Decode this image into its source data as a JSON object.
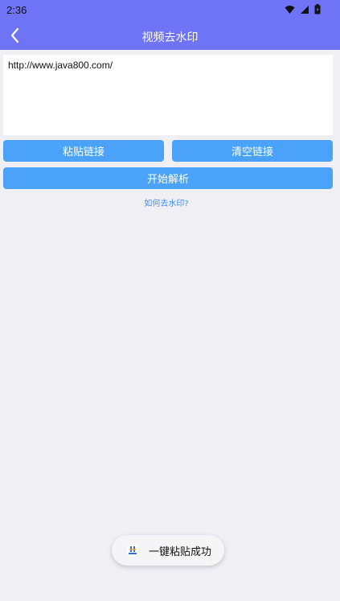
{
  "status_bar": {
    "time": "2:36"
  },
  "app_bar": {
    "title": "视频去水印"
  },
  "url_input": {
    "value": "http://www.java800.com/"
  },
  "buttons": {
    "paste_label": "粘贴链接",
    "clear_label": "清空链接",
    "parse_label": "开始解析"
  },
  "help": {
    "label": "如何去水印?"
  },
  "toast": {
    "message": "一键粘贴成功"
  },
  "colors": {
    "header": "#6f73f5",
    "button": "#4aa3f8",
    "link": "#3b8ff3",
    "background": "#efeff4"
  },
  "icons": {
    "wifi": "wifi-icon",
    "signal": "signal-icon",
    "battery": "battery-icon",
    "back": "back-arrow-icon",
    "toast": "app-logo-icon"
  }
}
